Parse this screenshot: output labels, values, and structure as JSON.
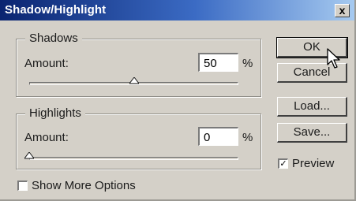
{
  "window": {
    "title": "Shadow/Highlight",
    "close_label": "x"
  },
  "shadows": {
    "group_label": "Shadows",
    "amount_label": "Amount:",
    "amount_value": "50",
    "unit": "%",
    "slider_fraction": 0.5
  },
  "highlights": {
    "group_label": "Highlights",
    "amount_label": "Amount:",
    "amount_value": "0",
    "unit": "%",
    "slider_fraction": 0.0
  },
  "buttons": {
    "ok": "OK",
    "cancel": "Cancel",
    "load": "Load...",
    "save": "Save..."
  },
  "preview": {
    "label": "Preview",
    "checked": true,
    "check_glyph": "✓"
  },
  "show_more": {
    "label": "Show More Options",
    "checked": false
  },
  "icons": [
    "close-icon",
    "slider-thumb-icon",
    "mouse-pointer-icon"
  ]
}
